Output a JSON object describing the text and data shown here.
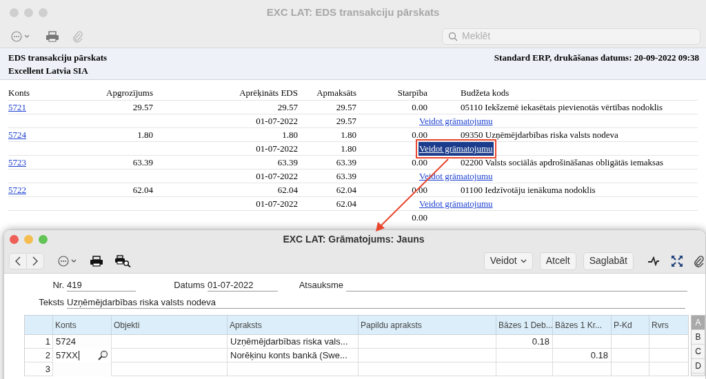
{
  "back_window": {
    "title": "EXC LAT: EDS transakciju pārskats",
    "search": {
      "placeholder": "Meklēt"
    },
    "report": {
      "title": "EDS transakciju pārskats",
      "company": "Excellent Latvia SIA",
      "header_right": "Standard ERP, drukāšanas datums: 20-09-2022 09:38",
      "columns": [
        "Konts",
        "Apgrozījums",
        "Aprēķināts EDS",
        "Apmaksāts",
        "Starpība",
        "Budžeta kods"
      ],
      "rows": [
        {
          "kind": "account",
          "konts": "5721",
          "apgrozijums": "29.57",
          "aprekinats": "29.57",
          "apmaksats": "29.57",
          "starpiba": "0.00",
          "budzeta_kods": "05110 Iekšzemē iekasētais pievienotās vērtības nodoklis"
        },
        {
          "kind": "payment",
          "date": "01-07-2022",
          "apmaksats": "29.57",
          "link": "Veidot grāmatojumu",
          "selected": false
        },
        {
          "kind": "account",
          "konts": "5724",
          "apgrozijums": "1.80",
          "aprekinats": "1.80",
          "apmaksats": "1.80",
          "starpiba": "0.00",
          "budzeta_kods": "09350 Uzņēmējdarbības riska valsts nodeva"
        },
        {
          "kind": "payment",
          "date": "01-07-2022",
          "apmaksats": "1.80",
          "link": "Veidot grāmatojumu",
          "selected": true
        },
        {
          "kind": "account",
          "konts": "5723",
          "apgrozijums": "63.39",
          "aprekinats": "63.39",
          "apmaksats": "63.39",
          "starpiba": "0.00",
          "budzeta_kods": "02200 Valsts sociālās apdrošināšanas obligātās iemaksas"
        },
        {
          "kind": "payment",
          "date": "01-07-2022",
          "apmaksats": "63.39",
          "link": "Veidot grāmatojumu",
          "selected": false
        },
        {
          "kind": "account",
          "konts": "5722",
          "apgrozijums": "62.04",
          "aprekinats": "62.04",
          "apmaksats": "62.04",
          "starpiba": "0.00",
          "budzeta_kods": "01100 Iedzīvotāju ienākuma nodoklis"
        },
        {
          "kind": "payment",
          "date": "01-07-2022",
          "apmaksats": "62.04",
          "link": "Veidot grāmatojumu",
          "selected": false
        }
      ],
      "total_starpiba": "0.00"
    }
  },
  "front_window": {
    "title": "EXC LAT: Grāmatojums: Jauns",
    "buttons": [
      {
        "label": "Veidot",
        "kind": "dropdown"
      },
      {
        "label": "Atcelt",
        "kind": "plain"
      },
      {
        "label": "Saglabāt",
        "kind": "plain"
      }
    ],
    "form": {
      "nr": {
        "label": "Nr.",
        "value": "419"
      },
      "datums": {
        "label": "Datums",
        "value": "01-07-2022"
      },
      "atsauksme": {
        "label": "Atsauksme"
      },
      "teksts": {
        "label": "Teksts",
        "value": "Uzņēmējdarbības riska valsts nodeva"
      }
    },
    "grid": {
      "columns": [
        "Konts",
        "Objekti",
        "Apraksts",
        "Papildu apraksts",
        "Bāzes 1 Deb...",
        "Bāzes 1 Kr...",
        "P-Kd",
        "Rvrs"
      ],
      "rows": [
        {
          "number": "1",
          "konts": "5724",
          "apraksts": "Uzņēmējdarbības riska vals...",
          "debit": "0.18",
          "active": false
        },
        {
          "number": "2",
          "konts": "57XX",
          "apraksts": "Norēķinu konts bankā (Swe...",
          "credit": "0.18",
          "active": true
        },
        {
          "number": "3",
          "active": false
        }
      ],
      "side_tabs": [
        {
          "label": "A",
          "selected": true
        },
        {
          "label": "B",
          "selected": false
        },
        {
          "label": "C",
          "selected": false
        },
        {
          "label": "D",
          "selected": false
        }
      ]
    }
  }
}
